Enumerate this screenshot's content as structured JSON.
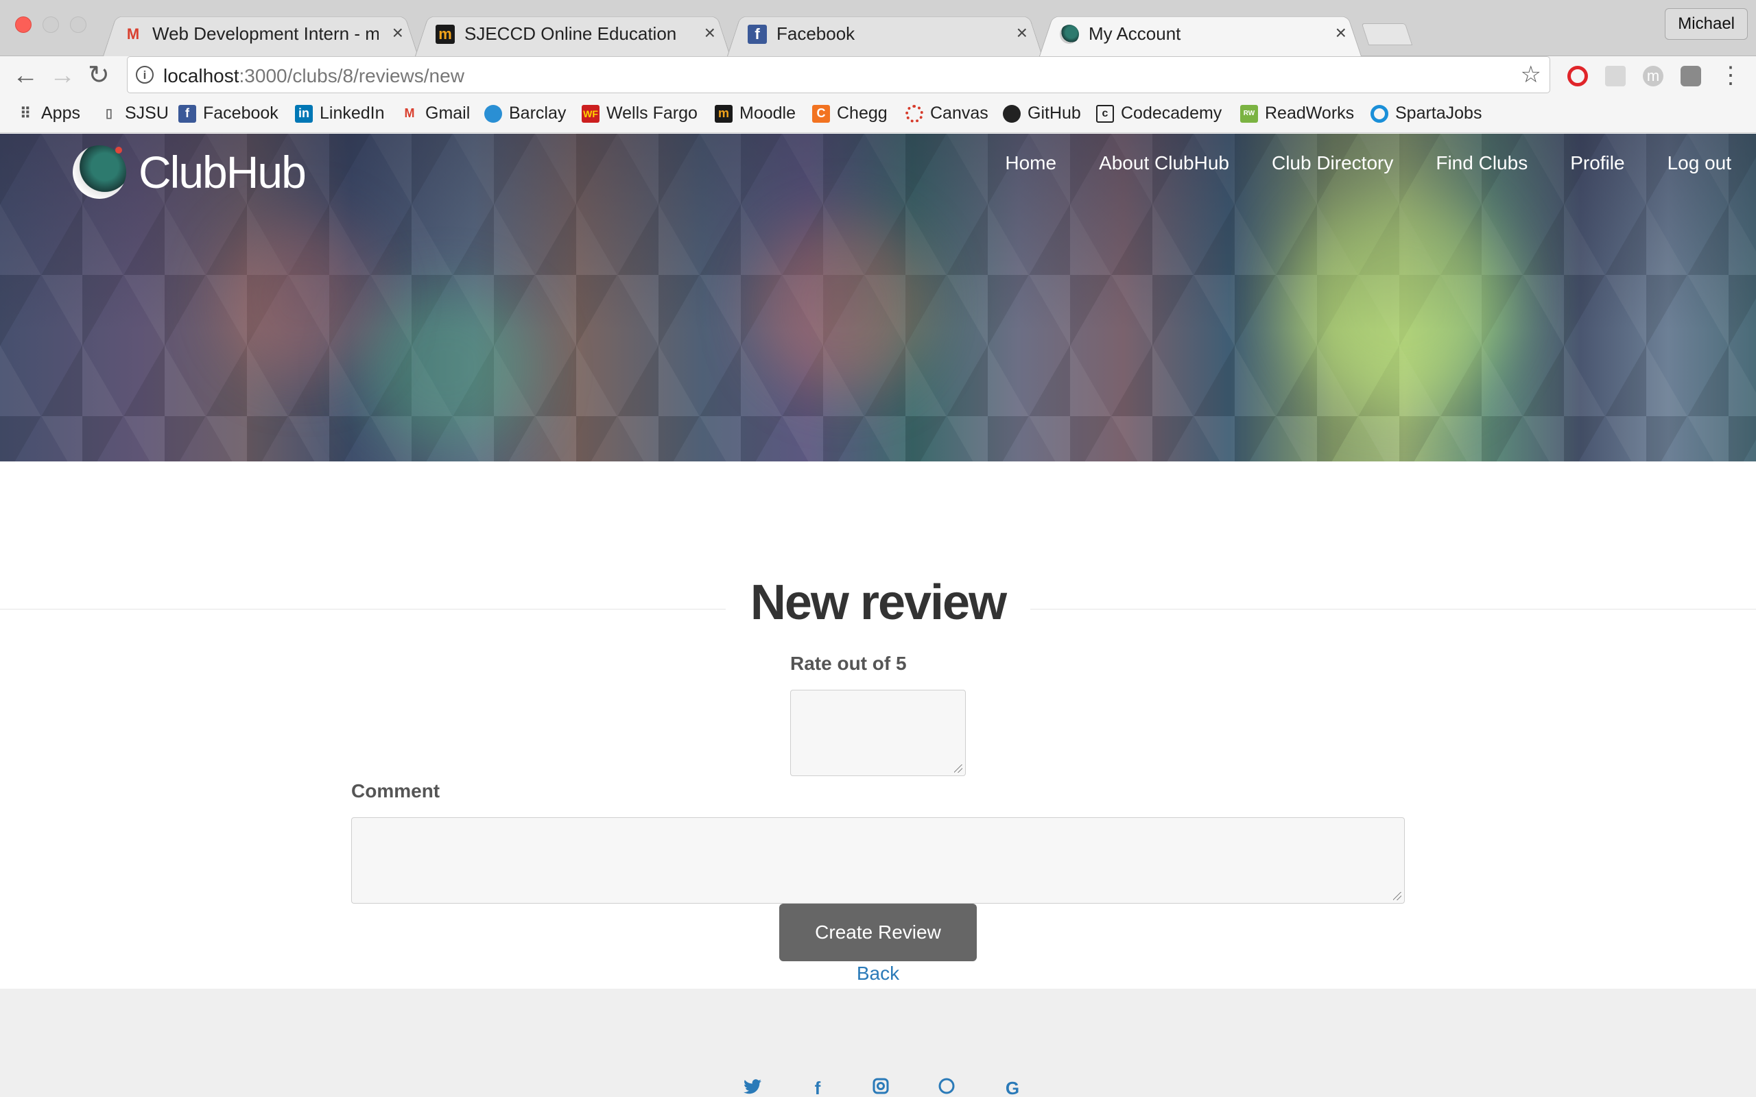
{
  "browser": {
    "tabs": [
      {
        "title": "Web Development Intern - mic",
        "icon": "gmail-icon",
        "active": false
      },
      {
        "title": "SJECCD Online Education",
        "icon": "moodle-icon",
        "active": false
      },
      {
        "title": "Facebook",
        "icon": "facebook-icon",
        "active": false
      },
      {
        "title": "My Account",
        "icon": "clubhub-icon",
        "active": true
      }
    ],
    "profile_name": "Michael",
    "url_host": "localhost",
    "url_path": ":3000/clubs/8/reviews/new",
    "bookmarks": [
      "Apps",
      "SJSU",
      "Facebook",
      "LinkedIn",
      "Gmail",
      "Barclay",
      "Wells Fargo",
      "Moodle",
      "Chegg",
      "Canvas",
      "GitHub",
      "Codecademy",
      "ReadWorks",
      "SpartaJobs"
    ]
  },
  "site": {
    "brand": "ClubHub",
    "nav": [
      "Home",
      "About ClubHub",
      "Club Directory",
      "Find Clubs",
      "Profile",
      "Log out"
    ]
  },
  "form": {
    "title": "New review",
    "rating_label": "Rate out of 5",
    "rating_value": "",
    "comment_label": "Comment",
    "comment_value": "",
    "submit_label": "Create Review",
    "back_label": "Back"
  },
  "footer": {
    "social_icons": [
      "twitter-icon",
      "facebook-icon",
      "instagram-icon",
      "github-icon",
      "google-icon"
    ]
  },
  "colors": {
    "button": "#666666",
    "link": "#2a7ab8",
    "footer_bg": "#efefef"
  }
}
